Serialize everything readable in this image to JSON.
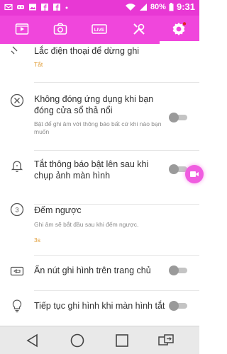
{
  "status_bar": {
    "battery_percent": "80%",
    "time": "9:31"
  },
  "tabs": [
    {
      "icon": "video-list-icon"
    },
    {
      "icon": "camera-icon"
    },
    {
      "icon": "live-icon",
      "badge_text": "LIVE"
    },
    {
      "icon": "tools-icon"
    },
    {
      "icon": "settings-icon",
      "active": true
    }
  ],
  "settings": [
    {
      "title": "Lắc điện thoại để dừng ghi",
      "value": "Tắt"
    },
    {
      "title": "Không đóng ứng dụng khi bạn đóng cửa sổ thả nổi",
      "subtitle": "Bật để ghi âm với thông báo bất cứ khi nào bạn muốn",
      "toggle": false
    },
    {
      "title": "Tắt thông báo bật lên sau khi chụp ảnh màn hình",
      "toggle": false
    },
    {
      "title": "Đếm ngược",
      "subtitle": "Ghi âm sẽ bắt đầu sau khi đếm ngược.",
      "value": "3s"
    },
    {
      "title": "Ẩn nút ghi hình trên trang chủ",
      "toggle": false
    },
    {
      "title": "Tiếp tục ghi hình khi màn hình tắt",
      "toggle": false
    }
  ],
  "colors": {
    "accent": "#f046dc",
    "value_text": "#e09b33"
  }
}
